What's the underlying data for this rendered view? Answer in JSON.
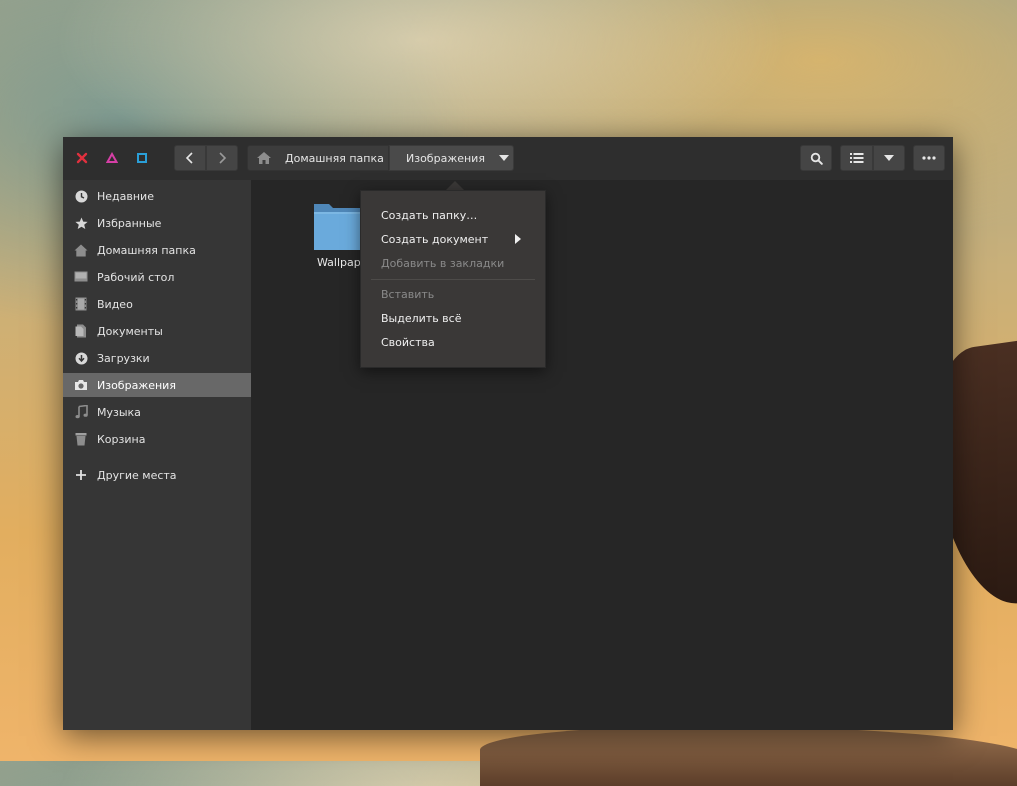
{
  "window": {
    "controls": {
      "close_icon": "x-icon",
      "minimize_icon": "triangle-icon",
      "maximize_icon": "square-icon",
      "colors": {
        "close": "#e0303e",
        "minimize": "#d63fa6",
        "maximize": "#2a9fd8"
      }
    }
  },
  "header": {
    "back_icon": "chevron-left-icon",
    "forward_icon": "chevron-right-icon",
    "breadcrumb": {
      "home_icon": "home-icon",
      "home_label": "Домашняя папка",
      "current_label": "Изображения",
      "dropdown_icon": "chevron-down-icon"
    },
    "search_icon": "search-icon",
    "view_list_icon": "list-icon",
    "view_options_icon": "chevron-down-icon",
    "menu_icon": "more-horizontal-icon"
  },
  "sidebar": {
    "items": [
      {
        "label": "Недавние",
        "icon": "clock-icon"
      },
      {
        "label": "Избранные",
        "icon": "star-icon"
      },
      {
        "label": "Домашняя папка",
        "icon": "home-icon"
      },
      {
        "label": "Рабочий стол",
        "icon": "desktop-icon"
      },
      {
        "label": "Видео",
        "icon": "film-icon"
      },
      {
        "label": "Документы",
        "icon": "document-icon"
      },
      {
        "label": "Загрузки",
        "icon": "download-icon"
      },
      {
        "label": "Изображения",
        "icon": "camera-icon",
        "active": true
      },
      {
        "label": "Музыка",
        "icon": "music-icon"
      },
      {
        "label": "Корзина",
        "icon": "trash-icon"
      }
    ],
    "other_places": {
      "label": "Другие места",
      "icon": "plus-icon"
    }
  },
  "main": {
    "files": [
      {
        "name": "Wallpap",
        "icon": "folder-icon"
      }
    ]
  },
  "context_menu": {
    "items": [
      {
        "label": "Создать папку…",
        "enabled": true
      },
      {
        "label": "Создать документ",
        "enabled": true,
        "submenu": true
      },
      {
        "label": "Добавить в закладки",
        "enabled": false
      },
      {
        "label": "Вставить",
        "enabled": false
      },
      {
        "label": "Выделить всё",
        "enabled": true
      },
      {
        "label": "Свойства",
        "enabled": true
      }
    ],
    "submenu_icon": "triangle-right-icon"
  }
}
